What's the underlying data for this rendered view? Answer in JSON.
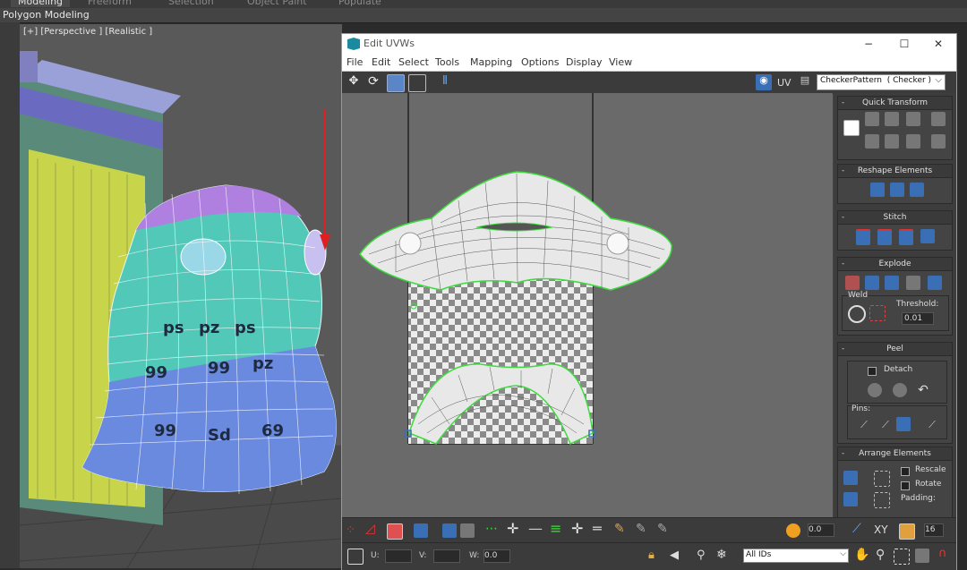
{
  "ribbon": {
    "tabs": [
      "Modeling",
      "Freeform",
      "Selection",
      "Object Paint",
      "Populate"
    ],
    "active": "Modeling"
  },
  "polybar": {
    "label": "Polygon Modeling"
  },
  "viewport": {
    "label": "[+] [Perspective ] [Realistic ]"
  },
  "uvw": {
    "title": "Edit UVWs",
    "menu": [
      "File",
      "Edit",
      "Select",
      "Tools",
      "Mapping",
      "Options",
      "Display",
      "View"
    ],
    "uv_label": "UV",
    "texture": "CheckerPattern  ( Checker )",
    "win_min": "−",
    "win_max": "☐",
    "win_close": "✕"
  },
  "panel": {
    "quick_transform": "Quick Transform",
    "reshape": "Reshape Elements",
    "stitch": "Stitch",
    "explode": "Explode",
    "weld": "Weld",
    "threshold_label": "Threshold:",
    "threshold_value": "0.01",
    "peel": "Peel",
    "detach": "Detach",
    "pins": "Pins:",
    "arrange": "Arrange Elements",
    "rescale": "Rescale",
    "rotate": "Rotate",
    "padding": "Padding:",
    "minus": "-"
  },
  "bottom": {
    "value1": "0.0",
    "xy": "XY",
    "value2": "16",
    "u_label": "U:",
    "v_label": "V:",
    "w_label": "W:",
    "w_value": "0.0",
    "ids": "All IDs"
  },
  "colors": {
    "accent_blue": "#3b6fb5",
    "uv_green": "#3ddc3d",
    "checker_dark": "#8a8a8a"
  }
}
